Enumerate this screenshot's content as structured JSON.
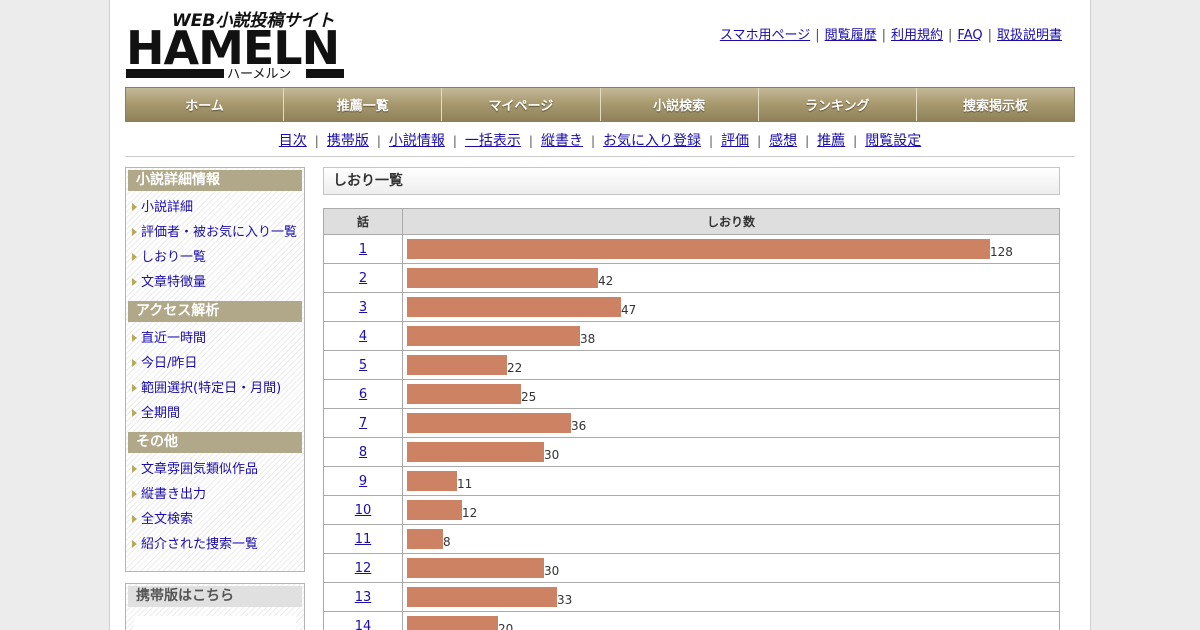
{
  "logo": {
    "tagline": "WEB小説投稿サイト",
    "name": "HAMELN",
    "reading": "ハーメルン"
  },
  "top_links": [
    "スマホ用ページ",
    "閲覧履歴",
    "利用規約",
    "FAQ",
    "取扱説明書"
  ],
  "main_nav": [
    "ホーム",
    "推薦一覧",
    "マイページ",
    "小説検索",
    "ランキング",
    "捜索掲示板"
  ],
  "sub_nav": [
    "目次",
    "携帯版",
    "小説情報",
    "一括表示",
    "縦書き",
    "お気に入り登録",
    "評価",
    "感想",
    "推薦",
    "閲覧設定"
  ],
  "sidebar": {
    "sections": [
      {
        "title": "小説詳細情報",
        "items": [
          "小説詳細",
          "評価者・被お気に入り一覧",
          "しおり一覧",
          "文章特徴量"
        ]
      },
      {
        "title": "アクセス解析",
        "items": [
          "直近一時間",
          "今日/昨日",
          "範囲選択(特定日・月間)",
          "全期間"
        ]
      },
      {
        "title": "その他",
        "items": [
          "文章雰囲気類似作品",
          "縦書き出力",
          "全文検索",
          "紹介された捜索一覧"
        ]
      }
    ],
    "mobile_box_title": "携帯版はこちら"
  },
  "content": {
    "title": "しおり一覧",
    "col_episode": "話",
    "col_count": "しおり数"
  },
  "bar_color": "#cd8264",
  "chart_data": {
    "type": "bar",
    "categories": [
      "1",
      "2",
      "3",
      "4",
      "5",
      "6",
      "7",
      "8",
      "9",
      "10",
      "11",
      "12",
      "13",
      "14"
    ],
    "values": [
      128,
      42,
      47,
      38,
      22,
      25,
      36,
      30,
      11,
      12,
      8,
      30,
      33,
      20
    ],
    "xlabel": "話",
    "ylabel": "しおり数",
    "max": 128
  }
}
